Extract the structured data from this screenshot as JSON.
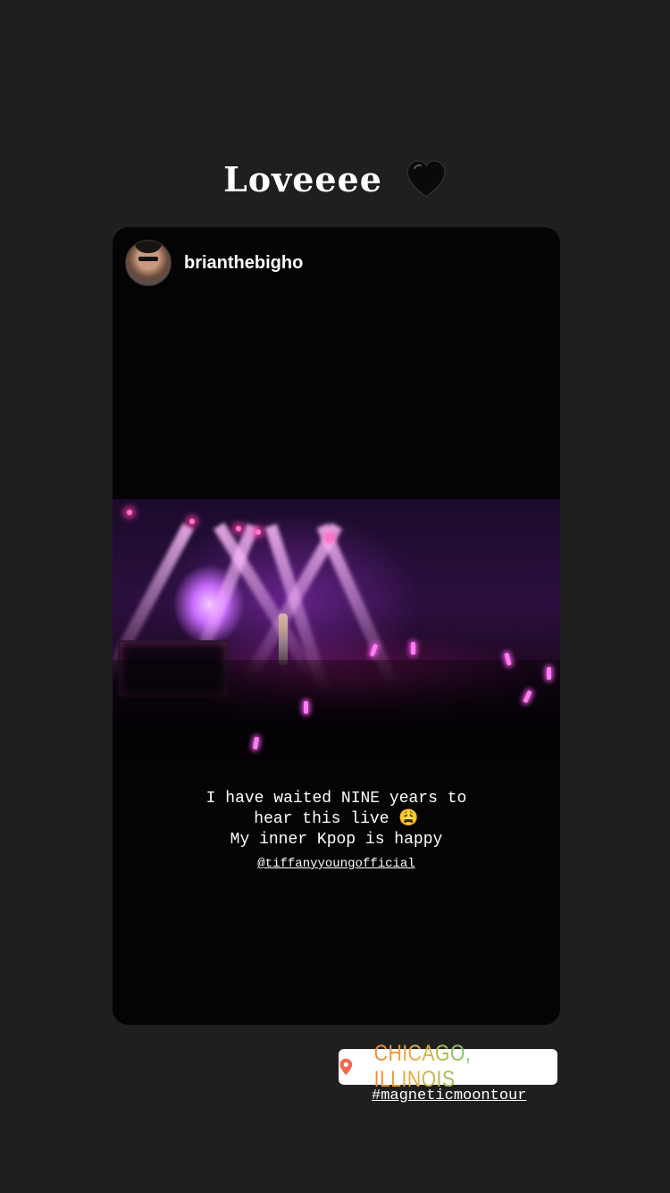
{
  "story": {
    "caption": "Loveeee",
    "caption_emoji_icon": "black-heart-icon"
  },
  "reshared_post": {
    "username": "brianthebigho",
    "text_lines": [
      "I have waited NINE years to",
      "hear this live 😩",
      "My inner Kpop is happy"
    ],
    "mention": "@tiffanyyoungofficial"
  },
  "stickers": {
    "location": "CHICAGO, ILLINOIS",
    "location_icon": "location-pin-icon",
    "hashtag": "#magneticmoontour"
  },
  "colors": {
    "background": "#1f1f1f",
    "card": "#050304",
    "stage_accent": "#c96cff",
    "pin": "#f06a4f"
  }
}
